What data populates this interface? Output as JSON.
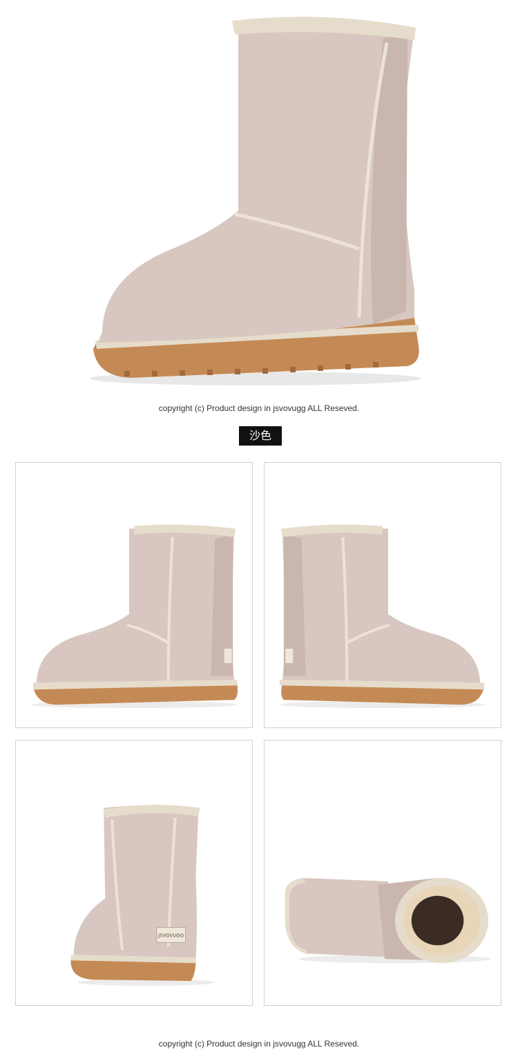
{
  "hero": {
    "image": "sand-suede-mid-calf-boot-side-view"
  },
  "copyright_top": "copyright (c) Product design in jsvovugg ALL Reseved.",
  "color_label": "沙色",
  "gallery": [
    {
      "image": "boot-left-side-view"
    },
    {
      "image": "boot-right-side-view"
    },
    {
      "image": "boot-rear-view-with-label"
    },
    {
      "image": "boot-lying-top-view-sheepskin-lining"
    }
  ],
  "boot_label_text": "JSVOVUGG",
  "colors": {
    "suede": "#d8c7c0",
    "suede_shadow": "#c3b0a9",
    "trim": "#e6dccb",
    "sole": "#c48a55",
    "sole_dark": "#a06a3c",
    "fur": "#e9d6b8"
  },
  "copyright_bottom": "copyright (c) Product design in jsvovugg ALL Reseved."
}
